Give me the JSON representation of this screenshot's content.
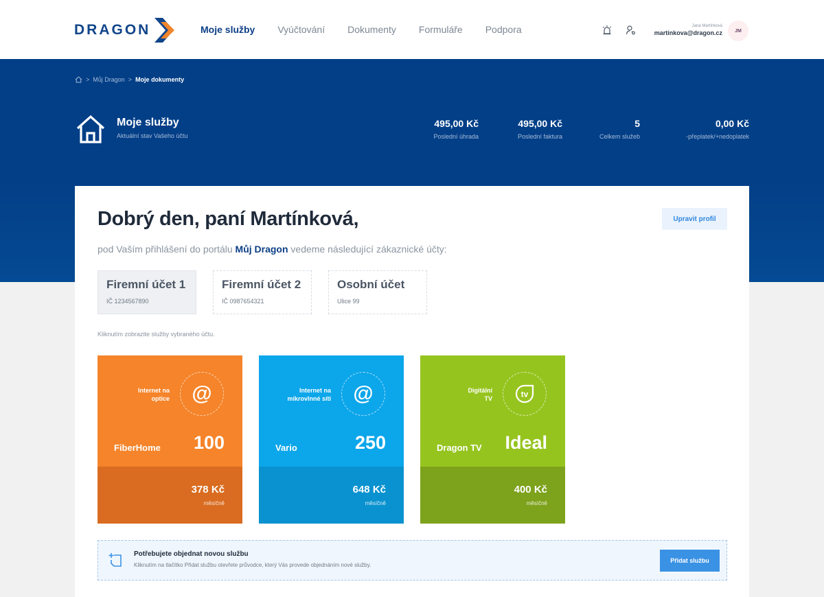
{
  "brand": {
    "name": "DRAGON",
    "primary": "#11458a",
    "accent": "#f0852d"
  },
  "nav": [
    {
      "label": "Moje služby",
      "active": true
    },
    {
      "label": "Vyúčtování",
      "active": false
    },
    {
      "label": "Dokumenty",
      "active": false
    },
    {
      "label": "Formuláře",
      "active": false
    },
    {
      "label": "Podpora",
      "active": false
    }
  ],
  "header_icons": [
    "alarm-icon",
    "user-key-icon"
  ],
  "user": {
    "name": "Jana Martínková",
    "email": "martinkova@dragon.cz",
    "initials": "JM"
  },
  "breadcrumb": {
    "home_icon": "home-icon",
    "items": [
      "Můj Dragon",
      "Moje dokumenty"
    ]
  },
  "hero": {
    "title": "Moje služby",
    "subtitle": "Aktuální stav Vašeho účtu",
    "icon": "house-icon",
    "stats": [
      {
        "value": "495,00 Kč",
        "label": "Poslední úhrada"
      },
      {
        "value": "495,00 Kč",
        "label": "Poslední faktura"
      },
      {
        "value": "5",
        "label": "Celkem služeb"
      },
      {
        "value": "0,00 Kč",
        "label": "-přeplatek/+nedoplatek"
      }
    ]
  },
  "main": {
    "greeting": "Dobrý den, paní Martínková,",
    "edit_profile": "Upravit profil",
    "sub_before": "pod Vaším přihlášení do portálu ",
    "sub_brand": "Můj Dragon",
    "sub_after": " vedeme následující zákaznické účty:",
    "accounts": [
      {
        "name": "Firemní účet 1",
        "detail": "IČ 1234567890",
        "selected": true
      },
      {
        "name": "Firemní účet 2",
        "detail": "IČ 0987654321",
        "selected": false
      },
      {
        "name": "Osobní účet",
        "detail": "Ulice 99",
        "selected": false
      }
    ],
    "hint": "Kliknutím zobrazite služby vybraného účtu.",
    "services": [
      {
        "cat1": "Internet na",
        "cat2": "optice",
        "icon": "at-icon",
        "glyph": "@",
        "product": "FiberHome",
        "value": "100",
        "price": "378 Kč",
        "per": "měsíčně",
        "color_top": "#f5842a",
        "color_bottom": "#d96c20"
      },
      {
        "cat1": "Internet na",
        "cat2": "mikrovlnné síti",
        "icon": "at-icon",
        "glyph": "@",
        "product": "Vario",
        "value": "250",
        "price": "648 Kč",
        "per": "měsíčně",
        "color_top": "#0ca6ea",
        "color_bottom": "#0992cf"
      },
      {
        "cat1": "Digitální",
        "cat2": "TV",
        "icon": "tv-icon",
        "glyph": "tv",
        "product": "Dragon TV",
        "value": "Ideal",
        "price": "400 Kč",
        "per": "měsíčně",
        "color_top": "#96c41f",
        "color_bottom": "#7da21b"
      }
    ],
    "order": {
      "icon": "new-service-icon",
      "title": "Potřebujete objednat novou službu",
      "desc": "Kliknutím na tlačítko Přidat službu otevřete průvodce, který Vás provede objednáním nové služby.",
      "button": "Přidat službu"
    }
  }
}
